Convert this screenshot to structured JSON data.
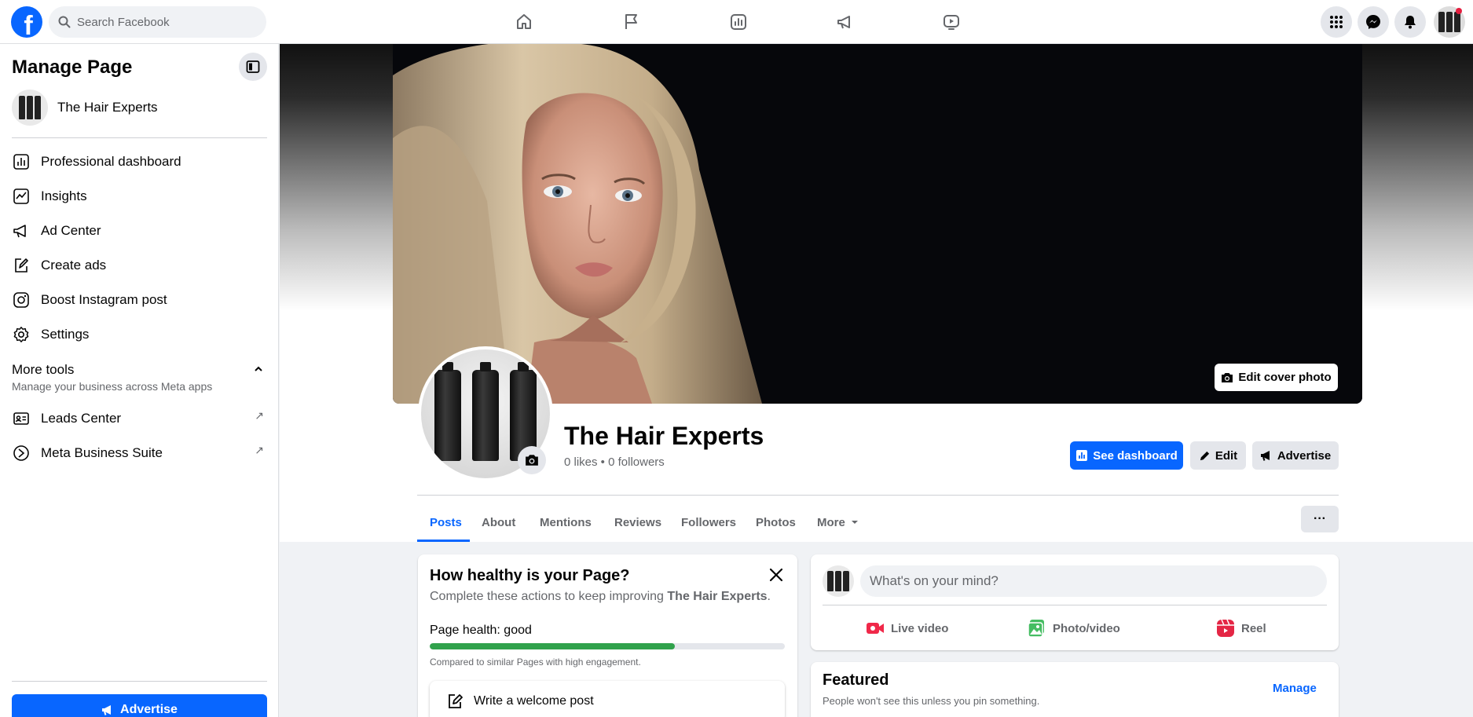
{
  "topbar": {
    "logo_letter": "f",
    "search_placeholder": "Search Facebook",
    "nav_icons": [
      "home-icon",
      "flag-icon",
      "dashboard-icon",
      "megaphone-icon",
      "video-icon"
    ],
    "right_icons": [
      "menu-grid-icon",
      "messenger-icon",
      "bell-icon"
    ]
  },
  "sidebar": {
    "title": "Manage Page",
    "page_name": "The Hair Experts",
    "items": [
      {
        "label": "Professional dashboard",
        "icon": "chart-icon"
      },
      {
        "label": "Insights",
        "icon": "insights-icon"
      },
      {
        "label": "Ad Center",
        "icon": "megaphone-icon"
      },
      {
        "label": "Create ads",
        "icon": "pencil-square-icon"
      },
      {
        "label": "Boost Instagram post",
        "icon": "instagram-icon"
      },
      {
        "label": "Settings",
        "icon": "gear-icon"
      }
    ],
    "more_tools": {
      "title": "More tools",
      "subtitle": "Manage your business across Meta apps"
    },
    "tools": [
      {
        "label": "Leads Center",
        "icon": "id-card-icon"
      },
      {
        "label": "Meta Business Suite",
        "icon": "meta-icon"
      }
    ],
    "advertise_label": "Advertise"
  },
  "header": {
    "edit_cover_label": "Edit cover photo",
    "page_name": "The Hair Experts",
    "stats": "0 likes • 0 followers",
    "buttons": {
      "dashboard": "See dashboard",
      "edit": "Edit",
      "advertise": "Advertise"
    },
    "tabs": [
      "Posts",
      "About",
      "Mentions",
      "Reviews",
      "Followers",
      "Photos",
      "More"
    ],
    "active_tab": "Posts",
    "more_menu": "···"
  },
  "health": {
    "title": "How healthy is your Page?",
    "subtitle_prefix": "Complete these actions to keep improving ",
    "subtitle_page": "The Hair Experts",
    "subtitle_suffix": ".",
    "label": "Page health: good",
    "progress": 0.69,
    "note": "Compared to similar Pages with high engagement.",
    "welcome_post": "Write a welcome post"
  },
  "composer": {
    "placeholder": "What's on your mind?",
    "actions": [
      "Live video",
      "Photo/video",
      "Reel"
    ]
  },
  "featured": {
    "title": "Featured",
    "subtitle": "People won't see this unless you pin something.",
    "manage": "Manage"
  },
  "colors": {
    "brand_blue": "#0866ff",
    "health_green": "#31a24c",
    "live_red": "#f02849",
    "photo_green": "#45bd62",
    "reel_pink": "#e42645"
  }
}
